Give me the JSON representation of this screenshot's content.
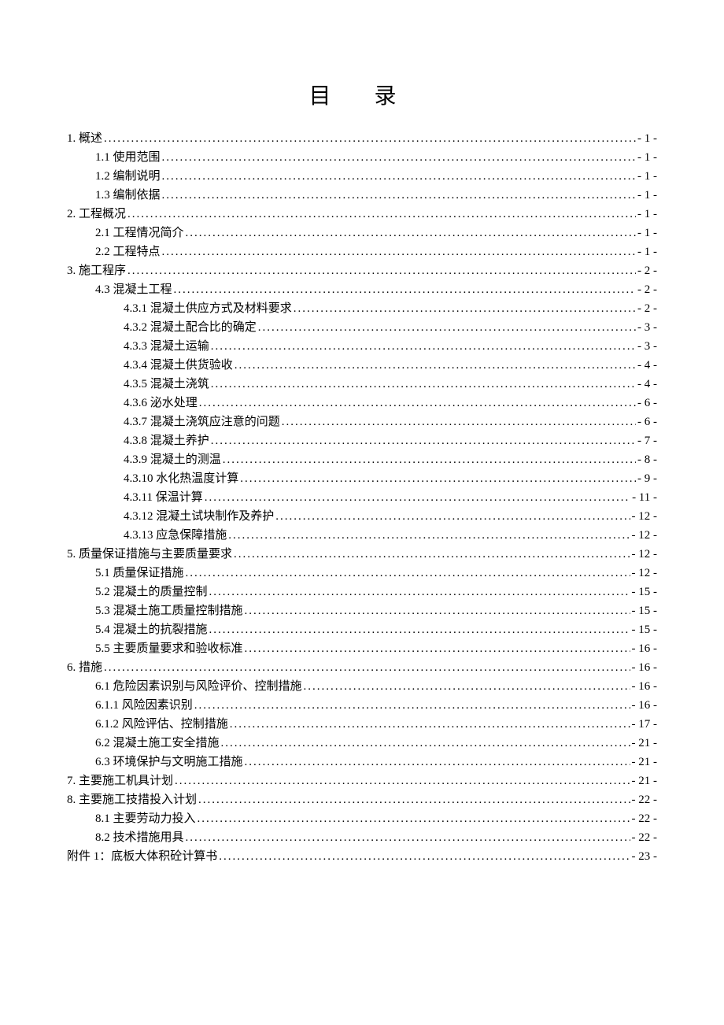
{
  "title": "目 录",
  "entries": [
    {
      "level": 0,
      "label": "1. 概述",
      "page": "- 1 -"
    },
    {
      "level": 1,
      "label": "1.1 使用范围",
      "page": "- 1 -"
    },
    {
      "level": 1,
      "label": "1.2 编制说明",
      "page": "- 1 -"
    },
    {
      "level": 1,
      "label": "1.3 编制依据",
      "page": "- 1 -"
    },
    {
      "level": 0,
      "label": "2. 工程概况",
      "page": "- 1 -"
    },
    {
      "level": 1,
      "label": "2.1 工程情况简介",
      "page": "- 1 -"
    },
    {
      "level": 1,
      "label": "2.2 工程特点",
      "page": "- 1 -"
    },
    {
      "level": 0,
      "label": "3. 施工程序",
      "page": "- 2 -"
    },
    {
      "level": 1,
      "label": "4.3 混凝土工程",
      "page": "- 2 -"
    },
    {
      "level": 2,
      "label": "4.3.1 混凝土供应方式及材料要求",
      "page": "- 2 -"
    },
    {
      "level": 2,
      "label": "4.3.2 混凝土配合比的确定",
      "page": "- 3 -"
    },
    {
      "level": 2,
      "label": "4.3.3 混凝土运输",
      "page": "- 3 -"
    },
    {
      "level": 2,
      "label": "4.3.4 混凝土供货验收",
      "page": "- 4 -"
    },
    {
      "level": 2,
      "label": "4.3.5 混凝土浇筑",
      "page": "- 4 -"
    },
    {
      "level": 2,
      "label": "4.3.6 泌水处理",
      "page": "- 6 -"
    },
    {
      "level": 2,
      "label": "4.3.7 混凝土浇筑应注意的问题",
      "page": "- 6 -"
    },
    {
      "level": 2,
      "label": "4.3.8 混凝土养护",
      "page": "- 7 -"
    },
    {
      "level": 2,
      "label": "4.3.9 混凝土的测温",
      "page": "- 8 -"
    },
    {
      "level": 2,
      "label": "4.3.10 水化热温度计算",
      "page": "- 9 -"
    },
    {
      "level": 2,
      "label": "4.3.11 保温计算",
      "page": "- 11 -"
    },
    {
      "level": 2,
      "label": "4.3.12 混凝土试块制作及养护",
      "page": "- 12 -"
    },
    {
      "level": 2,
      "label": "4.3.13 应急保障措施",
      "page": "- 12 -"
    },
    {
      "level": 0,
      "label": "5. 质量保证措施与主要质量要求",
      "page": "- 12 -"
    },
    {
      "level": 1,
      "label": "5.1 质量保证措施",
      "page": "- 12 -"
    },
    {
      "level": 1,
      "label": "5.2 混凝土的质量控制",
      "page": "- 15 -"
    },
    {
      "level": 1,
      "label": "5.3 混凝土施工质量控制措施",
      "page": "- 15 -"
    },
    {
      "level": 1,
      "label": "5.4 混凝土的抗裂措施",
      "page": "- 15 -"
    },
    {
      "level": 1,
      "label": "5.5 主要质量要求和验收标准",
      "page": "- 16 -"
    },
    {
      "level": 0,
      "label": "6. 措施",
      "page": "- 16 -"
    },
    {
      "level": 1,
      "label": "6.1 危险因素识别与风险评价、控制措施",
      "page": "- 16 -"
    },
    {
      "level": 1,
      "label": "6.1.1 风险因素识别",
      "page": "- 16 -"
    },
    {
      "level": 1,
      "label": "6.1.2 风险评估、控制措施",
      "page": "- 17 -"
    },
    {
      "level": 1,
      "label": "6.2 混凝土施工安全措施",
      "page": "- 21 -"
    },
    {
      "level": 1,
      "label": "6.3 环境保护与文明施工措施",
      "page": "- 21 -"
    },
    {
      "level": 0,
      "label": "7. 主要施工机具计划",
      "page": "- 21 -"
    },
    {
      "level": 0,
      "label": "8. 主要施工技措投入计划",
      "page": "- 22 -"
    },
    {
      "level": 1,
      "label": "8.1 主要劳动力投入",
      "page": "- 22 -"
    },
    {
      "level": 1,
      "label": "8.2 技术措施用具",
      "page": "- 22 -"
    },
    {
      "level": 0,
      "label": "附件 1：底板大体积砼计算书",
      "page": "- 23 -"
    }
  ]
}
